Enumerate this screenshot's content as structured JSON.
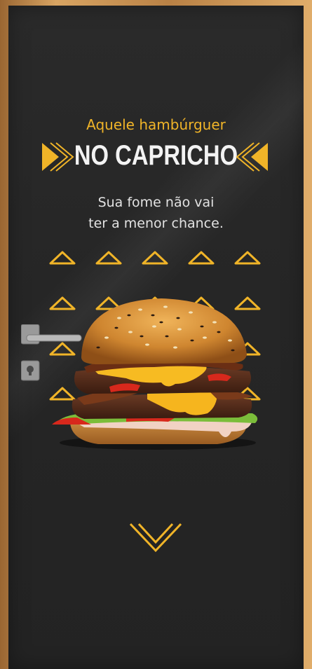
{
  "headline": "Aquele hambúrguer",
  "title": "NO CAPRICHO",
  "subtitle_lines": [
    "Sua fome não vai",
    "ter a menor chance."
  ],
  "colors": {
    "accent": "#f0b428",
    "background": "#262626",
    "door_frame": "#c08a4a",
    "text": "#f3f3f3"
  },
  "icons": {
    "left_arrow": "double-chevron-right-icon",
    "right_arrow": "double-chevron-left-icon",
    "triangle_pattern": "triangle-up-icon",
    "down_arrow": "chevron-down-icon",
    "handle": "door-handle-icon",
    "lock": "door-lock-icon",
    "burger_image": "burger-image"
  }
}
